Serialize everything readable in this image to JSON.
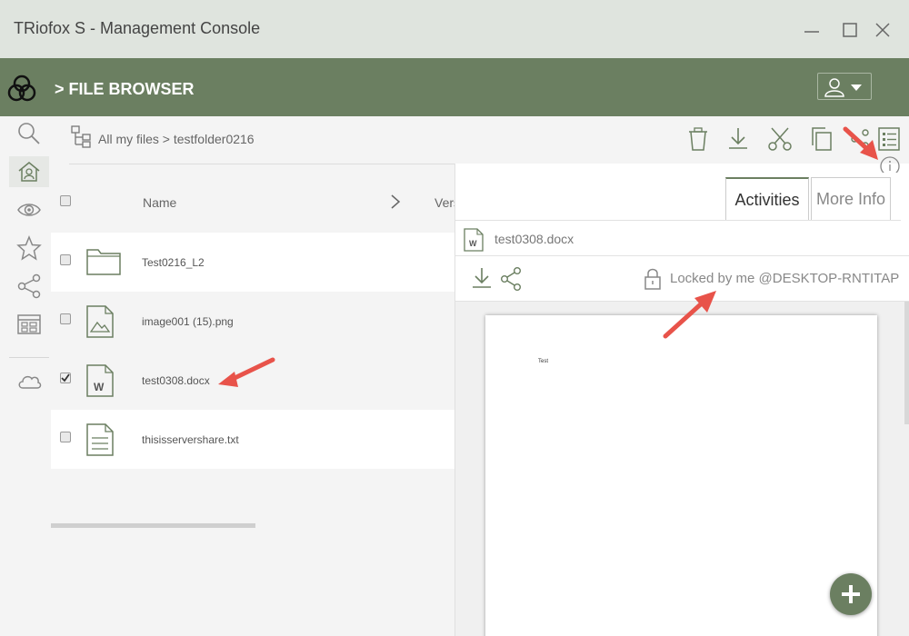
{
  "window": {
    "title": "TRiofox S -  Management Console"
  },
  "header": {
    "heading": "> FILE BROWSER"
  },
  "breadcrumb": {
    "text": "All my files > testfolder0216"
  },
  "list": {
    "column_name": "Name",
    "column_version": "Version",
    "rows": [
      {
        "name": "Test0216_L2",
        "type": "folder",
        "checked": false
      },
      {
        "name": "image001 (15).png",
        "type": "image",
        "checked": false
      },
      {
        "name": "test0308.docx",
        "type": "word",
        "checked": true
      },
      {
        "name": "thisisservershare.txt",
        "type": "text",
        "checked": false
      }
    ]
  },
  "panel": {
    "tabs": [
      "Activities",
      "More Info"
    ],
    "active_tab": "Activities",
    "file_name": "test0308.docx",
    "lock_status": "Locked by me @DESKTOP-RNTITAP",
    "preview_text": "Test"
  },
  "icons": [
    "search-icon",
    "home-icon",
    "eye-icon",
    "star-icon",
    "share-icon",
    "grid-icon",
    "cloud-icon",
    "delete-icon",
    "download-icon",
    "cut-icon",
    "copy-icon",
    "list-icon",
    "lock-icon",
    "plus-icon"
  ],
  "colors": {
    "header_bg": "#6b7f61",
    "titlebar_bg": "#dfe4de",
    "accent": "#6b7f61",
    "annotation_arrow": "#e8534a"
  }
}
